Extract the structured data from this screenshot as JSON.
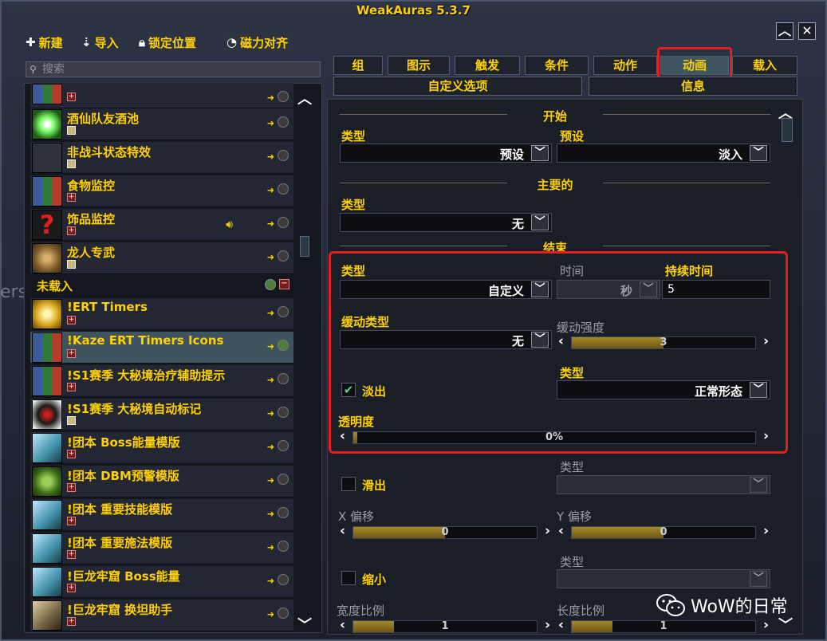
{
  "window": {
    "title": "WeakAuras 5.3.7",
    "collapse_icon": "chevron-up",
    "close_icon": "x"
  },
  "toolbar": {
    "new": "新建",
    "import": "导入",
    "lock": "锁定位置",
    "magnet": "磁力对齐"
  },
  "search": {
    "placeholder": "搜索"
  },
  "background_text": "ers Icons",
  "list": {
    "items": [
      {
        "name": "",
        "icon": "grid-icon",
        "dot": "off"
      },
      {
        "name": "酒仙队友酒池",
        "icon": "green-burst-icon",
        "dot": "off"
      },
      {
        "name": "非战斗状态特效",
        "icon": "dark-icon",
        "dot": "off"
      },
      {
        "name": "食物监控",
        "icon": "grid-icon",
        "dot": "off"
      },
      {
        "name": "饰品监控",
        "icon": "red-question-icon",
        "dot": "off",
        "speaker": "speaker-icon"
      },
      {
        "name": "龙人专武",
        "icon": "dragon-icon",
        "dot": "off"
      }
    ],
    "group_label": "未载入",
    "unloaded": [
      {
        "name": "!ERT Timers",
        "icon": "gold-orb-icon"
      },
      {
        "name": "!Kaze ERT Timers Icons",
        "icon": "grid-icon",
        "selected": true
      },
      {
        "name": "!S1赛季 大秘境治疗辅助提示",
        "icon": "grid-icon"
      },
      {
        "name": "!S1赛季 大秘境自动标记",
        "icon": "skull-icon"
      },
      {
        "name": "!团本 Boss能量模版",
        "icon": "crystal-icon"
      },
      {
        "name": "!团本 DBM预警模版",
        "icon": "green-ogre-icon"
      },
      {
        "name": "!团本 重要技能模版",
        "icon": "crystal-icon"
      },
      {
        "name": "!团本 重要施法模版",
        "icon": "crystal-icon"
      },
      {
        "name": "!巨龙牢窟 Boss能量",
        "icon": "crystal-icon"
      },
      {
        "name": "!巨龙牢窟 换坦助手",
        "icon": "sword-icon"
      }
    ]
  },
  "tabs": {
    "row1": [
      "组",
      "图示",
      "触发",
      "条件",
      "动作",
      "动画",
      "载入"
    ],
    "row2": [
      "自定义选项",
      "信息"
    ],
    "active": "动画"
  },
  "animation": {
    "start": {
      "header": "开始",
      "type_label": "类型",
      "type_value": "预设",
      "preset_label": "预设",
      "preset_value": "淡入"
    },
    "main": {
      "header": "主要的",
      "type_label": "类型",
      "type_value": "无"
    },
    "finish": {
      "header": "结束",
      "type_label": "类型",
      "type_value": "自定义",
      "time_label": "时间",
      "time_unit": "秒",
      "duration_label": "持续时间",
      "duration_value": "5",
      "easing_label": "缓动类型",
      "easing_value": "无",
      "easing_strength_label": "缓动强度",
      "easing_strength_value": "3",
      "fade_label": "淡出",
      "fade_checked": true,
      "fade_type_label": "类型",
      "fade_type_value": "正常形态",
      "alpha_label": "透明度",
      "alpha_value": "0%"
    },
    "slide": {
      "label": "滑出",
      "checked": false,
      "type_label": "类型",
      "type_value": "",
      "x_label": "X 偏移",
      "x_value": "0",
      "y_label": "Y 偏移",
      "y_value": "0"
    },
    "scale": {
      "label": "缩小",
      "checked": false,
      "type_label": "类型",
      "type_value": "",
      "width_label": "宽度比例",
      "width_value": "1",
      "height_label": "长度比例",
      "height_value": "1"
    }
  },
  "watermark": {
    "text": "WoW的日常"
  },
  "colors": {
    "gold": "#ffd100",
    "highlight_red": "#e0211f",
    "panel": "#1a1e27"
  }
}
